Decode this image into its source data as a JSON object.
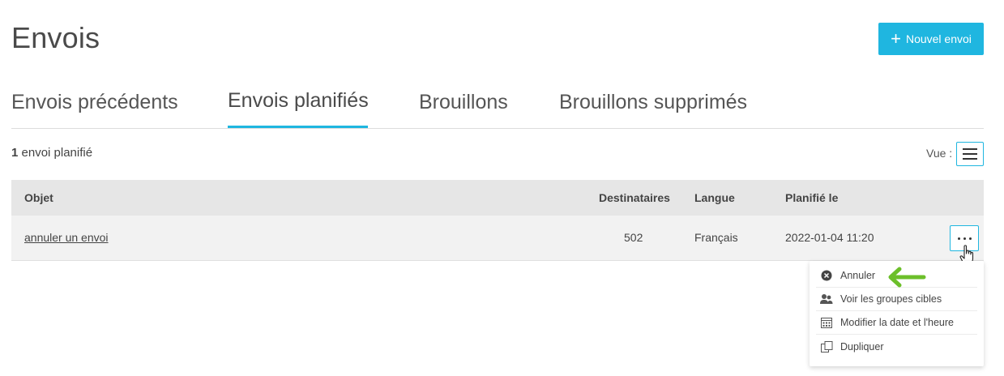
{
  "page": {
    "title": "Envois"
  },
  "header": {
    "new_button_label": "Nouvel envoi",
    "new_button_icon": "plus-icon"
  },
  "tabs": [
    {
      "label": "Envois précédents",
      "active": false
    },
    {
      "label": "Envois planifiés",
      "active": true
    },
    {
      "label": "Brouillons",
      "active": false
    },
    {
      "label": "Brouillons supprimés",
      "active": false
    }
  ],
  "summary": {
    "count": "1",
    "label": "envoi planifié"
  },
  "view": {
    "label": "Vue :",
    "icon": "list-view-icon"
  },
  "table": {
    "columns": [
      "Objet",
      "Destinataires",
      "Langue",
      "Planifié le"
    ],
    "rows": [
      {
        "objet": "annuler un envoi",
        "destinataires": "502",
        "langue": "Français",
        "planifie_le": "2022-01-04 11:20"
      }
    ]
  },
  "actions_menu": {
    "items": [
      {
        "label": "Annuler",
        "icon": "cancel-circle-icon"
      },
      {
        "label": "Voir les groupes cibles",
        "icon": "users-icon"
      },
      {
        "label": "Modifier la date et l'heure",
        "icon": "calendar-icon"
      },
      {
        "label": "Dupliquer",
        "icon": "duplicate-icon"
      }
    ]
  },
  "colors": {
    "accent": "#1fb6e0",
    "arrow": "#6cbf2a",
    "header_bg": "#e6e6e6",
    "row_bg": "#f2f2f2"
  }
}
